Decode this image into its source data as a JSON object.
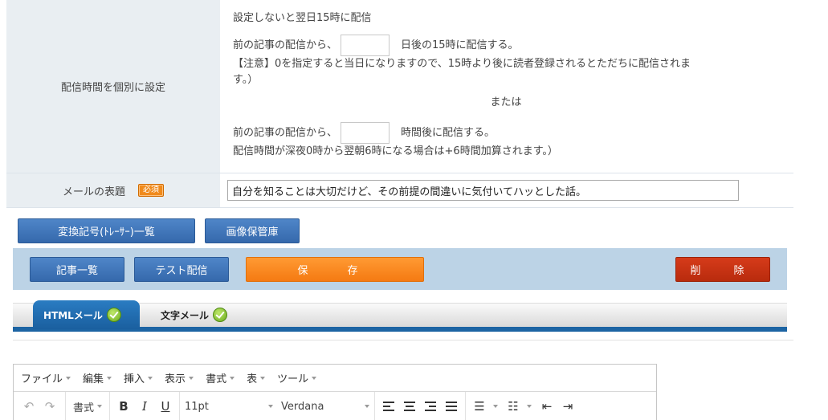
{
  "timing": {
    "label": "配信時間を個別に設定",
    "line1": "設定しないと翌日15時に配信",
    "days_prefix": "前の記事の配信から、",
    "days_suffix": "日後の15時に配信する。",
    "note1": "【注意】0を指定すると当日になりますので、15時より後に読者登録されるとただちに配信されま",
    "note1b": "す。）",
    "or_text": "または",
    "hours_prefix": "前の記事の配信から、",
    "hours_suffix": "時間後に配信する。",
    "note2": "配信時間が深夜0時から翌朝6時になる場合は+6時間加算されます。）"
  },
  "subject": {
    "label": "メールの表題",
    "required_badge": "必須",
    "value": "自分を知ることは大切だけど、その前提の間違いに気付いてハッとした話。"
  },
  "buttons": {
    "symbols": "変換記号(ﾄﾚｰｻｰ)一覧",
    "images": "画像保管庫",
    "articles": "記事一覧",
    "test_send": "テスト配信",
    "save": "保　存",
    "delete": "削　除"
  },
  "tabs": [
    {
      "label": "HTMLメール",
      "active": true
    },
    {
      "label": "文字メール",
      "active": false
    }
  ],
  "editor": {
    "menu": [
      "ファイル",
      "編集",
      "挿入",
      "表示",
      "書式",
      "表",
      "ツール"
    ],
    "format_label": "書式",
    "font_size": "11pt",
    "font_family": "Verdana"
  },
  "colors": {
    "primary_blue": "#3569ac",
    "save_orange": "#f57a12",
    "delete_red": "#b92b0d",
    "action_bar": "#bcd3e6",
    "label_bg": "#e9eef2"
  }
}
